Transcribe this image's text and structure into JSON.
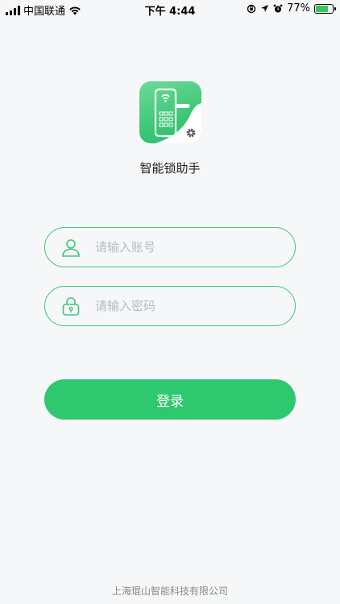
{
  "status_bar": {
    "carrier": "中国联通",
    "time": "下午 4:44",
    "battery": "77%",
    "battery_level": 0.77,
    "icons": [
      "signal-icon",
      "wifi-icon",
      "rotation-lock-icon",
      "location-arrow-icon",
      "alarm-icon",
      "battery-icon"
    ]
  },
  "app": {
    "name": "智能锁助手",
    "logo_icon": "smart-lock-icon"
  },
  "form": {
    "account_placeholder": "请输入账号",
    "account_value": "",
    "account_icon": "user-icon",
    "password_placeholder": "请输入密码",
    "password_value": "",
    "password_icon": "lock-icon",
    "login_label": "登录"
  },
  "footer": {
    "company": "上海琨山智能科技有限公司"
  },
  "colors": {
    "accent": "#2ec86f",
    "border": "#3cc777",
    "background": "#f6f7f9",
    "placeholder": "#b8bcc2"
  }
}
